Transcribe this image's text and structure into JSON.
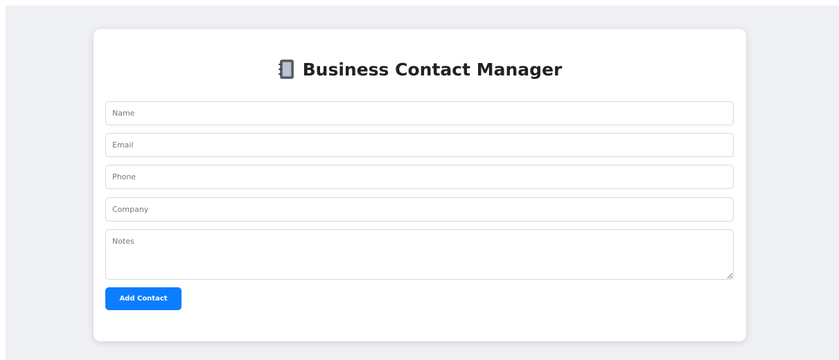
{
  "header": {
    "title": "Business Contact Manager",
    "icon": "notebook-icon"
  },
  "form": {
    "name_placeholder": "Name",
    "email_placeholder": "Email",
    "phone_placeholder": "Phone",
    "company_placeholder": "Company",
    "notes_placeholder": "Notes",
    "name_value": "",
    "email_value": "",
    "phone_value": "",
    "company_value": "",
    "notes_value": "",
    "submit_label": "Add Contact"
  },
  "colors": {
    "background": "#eef0f4",
    "card": "#ffffff",
    "accent": "#0b7dff",
    "title": "#222222"
  }
}
